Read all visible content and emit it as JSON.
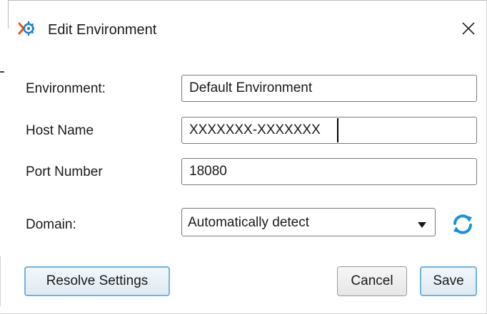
{
  "window": {
    "title": "Edit Environment",
    "app_icon": "environment-gear-icon",
    "close_icon": "close-icon"
  },
  "form": {
    "environment": {
      "label": "Environment:",
      "value": "Default Environment"
    },
    "host_name": {
      "label": "Host Name",
      "value": "XXXXXXX-XXXXXXX"
    },
    "port_number": {
      "label": "Port Number",
      "value": "18080"
    },
    "domain": {
      "label": "Domain:",
      "selected": "Automatically detect",
      "refresh_icon": "refresh-icon"
    }
  },
  "buttons": {
    "resolve": "Resolve Settings",
    "cancel": "Cancel",
    "save": "Save"
  },
  "colors": {
    "accent": "#1e90d6",
    "focus_border": "#6fb4e0",
    "icon_orange": "#e8541e"
  }
}
